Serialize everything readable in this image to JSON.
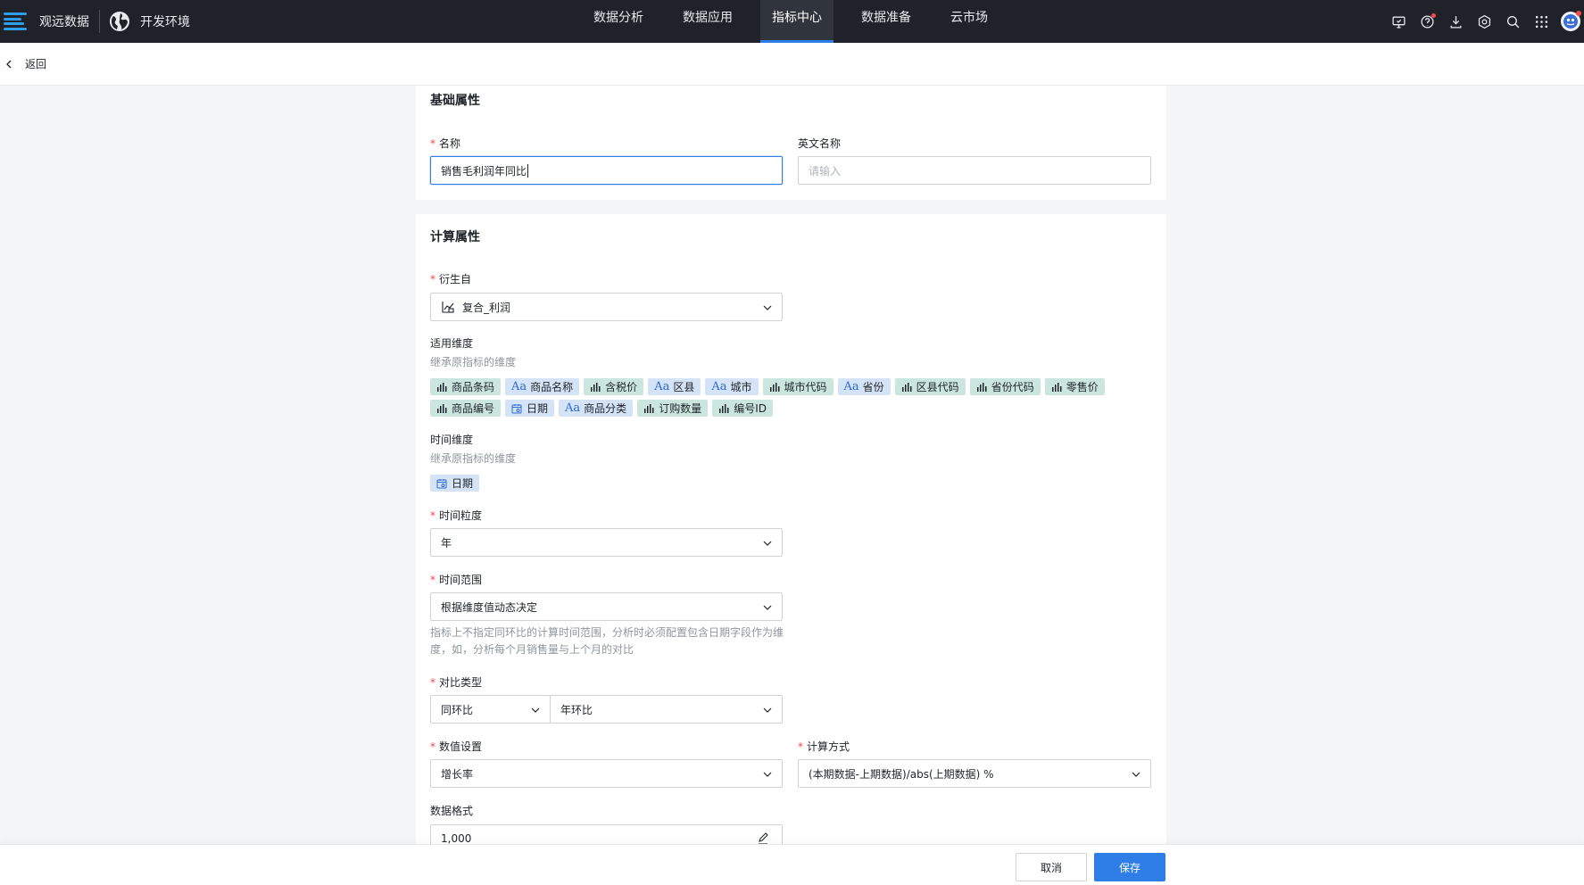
{
  "topbar": {
    "brand": "观远数据",
    "env": "开发环境",
    "nav": [
      {
        "label": "数据分析",
        "active": false
      },
      {
        "label": "数据应用",
        "active": false
      },
      {
        "label": "指标中心",
        "active": true
      },
      {
        "label": "数据准备",
        "active": false
      },
      {
        "label": "云市场",
        "active": false
      }
    ],
    "tools": [
      "monitor-icon",
      "help-icon",
      "download-icon",
      "settings-icon",
      "search-icon",
      "apps-icon"
    ]
  },
  "back": {
    "label": "返回"
  },
  "basic": {
    "title": "基础属性",
    "name_label": "名称",
    "name_value": "销售毛利润年同比",
    "en_label": "英文名称",
    "en_placeholder": "请输入"
  },
  "calc": {
    "title": "计算属性",
    "derived_label": "衍生自",
    "derived_value": "复合_利润",
    "dims_label": "适用维度",
    "dims_hint": "继承原指标的维度",
    "dims_row1": [
      {
        "type": "dim",
        "label": "商品条码"
      },
      {
        "type": "text",
        "label": "商品名称"
      },
      {
        "type": "dim",
        "label": "含税价"
      },
      {
        "type": "text",
        "label": "区县"
      },
      {
        "type": "text",
        "label": "城市"
      },
      {
        "type": "dim",
        "label": "城市代码"
      },
      {
        "type": "text",
        "label": "省份"
      },
      {
        "type": "dim",
        "label": "区县代码"
      },
      {
        "type": "dim",
        "label": "省份代码"
      },
      {
        "type": "dim",
        "label": "零售价"
      }
    ],
    "dims_row2": [
      {
        "type": "dim",
        "label": "商品编号"
      },
      {
        "type": "date",
        "label": "日期"
      },
      {
        "type": "text",
        "label": "商品分类"
      },
      {
        "type": "dim",
        "label": "订购数量"
      },
      {
        "type": "dim",
        "label": "编号ID"
      }
    ],
    "time_dim_label": "时间维度",
    "time_dim_hint": "继承原指标的维度",
    "time_dim_tag": "日期",
    "granularity_label": "时间粒度",
    "granularity_value": "年",
    "range_label": "时间范围",
    "range_value": "根据维度值动态决定",
    "range_hint_1": "指标上不指定同环比的计算时间范围，分析时必须配置包含日期字段作为维",
    "range_hint_2": "度，如，分析每个月销售量与上个月的对比",
    "compare_label": "对比类型",
    "compare_value_1": "同环比",
    "compare_value_2": "年环比",
    "value_setting_label": "数值设置",
    "value_setting_value": "增长率",
    "calc_method_label": "计算方式",
    "calc_method_value": "(本期数据-上期数据)/abs(上期数据) %",
    "format_label": "数据格式",
    "format_value": "1,000"
  },
  "footer": {
    "cancel": "取消",
    "save": "保存"
  },
  "colors": {
    "topbar": "#1f2329",
    "accent": "#2f7ee8",
    "required": "#f5484b",
    "dim_tag": "#cbe6df",
    "text_tag": "#d5e3f7"
  }
}
